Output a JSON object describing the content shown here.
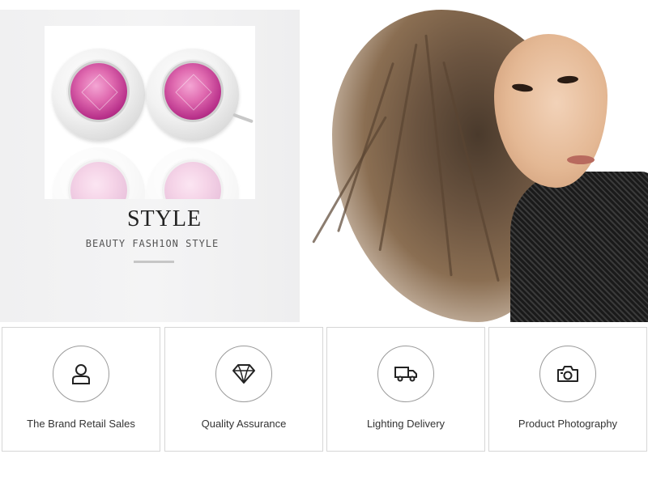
{
  "banner": {
    "title": "STYLE",
    "subtitle": "BEAUTY FASH1ON STYLE",
    "gem_color": "#d0579f",
    "background": "#f1f1f2"
  },
  "features": [
    {
      "label": "The Brand Retail Sales",
      "icon": "user-icon"
    },
    {
      "label": "Quality Assurance",
      "icon": "diamond-icon"
    },
    {
      "label": "Lighting Delivery",
      "icon": "truck-icon"
    },
    {
      "label": "Product Photography",
      "icon": "camera-icon"
    }
  ]
}
